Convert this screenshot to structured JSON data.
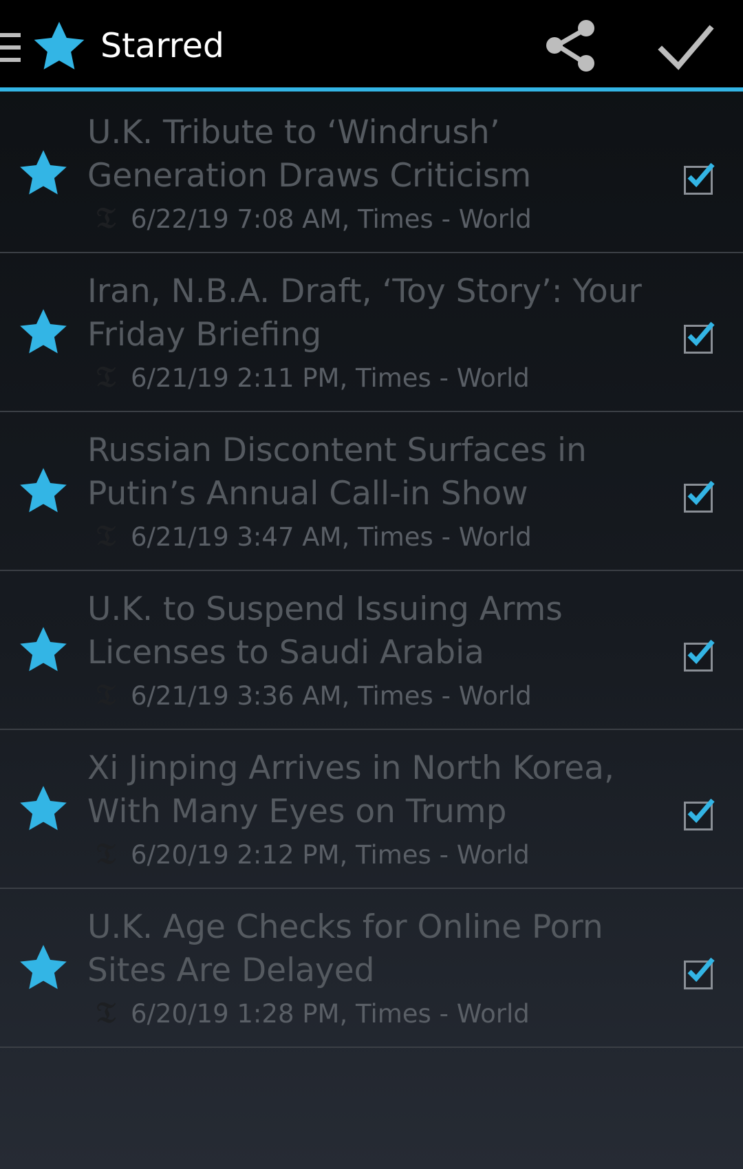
{
  "action_bar": {
    "title": "Starred",
    "icons": [
      "menu-icon",
      "star-icon",
      "share-icon",
      "checkmark-icon"
    ]
  },
  "colors": {
    "accent": "#33b5e5",
    "action_bar_bg": "#000000",
    "headline_text": "#555a60",
    "meta_text": "#5a5f66"
  },
  "articles": [
    {
      "headline_line1": "U.K. Tribute to ‘Windrush’",
      "headline_line2": "Generation Draws Criticism",
      "meta": "6/22/19 7:08 AM, Times - World",
      "starred": true,
      "checked": true
    },
    {
      "headline_line1": "Iran, N.B.A. Draft, ‘Toy Story’: Your",
      "headline_line2": "Friday Briefing",
      "meta": "6/21/19 2:11 PM, Times - World",
      "starred": true,
      "checked": true
    },
    {
      "headline_line1": "Russian Discontent Surfaces in",
      "headline_line2": "Putin’s Annual Call-in Show",
      "meta": "6/21/19 3:47 AM, Times - World",
      "starred": true,
      "checked": true
    },
    {
      "headline_line1": "U.K. to Suspend Issuing Arms",
      "headline_line2": "Licenses to Saudi Arabia",
      "meta": "6/21/19 3:36 AM, Times - World",
      "starred": true,
      "checked": true
    },
    {
      "headline_line1": "Xi Jinping Arrives in North Korea,",
      "headline_line2": "With Many Eyes on Trump",
      "meta": "6/20/19 2:12 PM, Times - World",
      "starred": true,
      "checked": true
    },
    {
      "headline_line1": "U.K. Age Checks for Online Porn",
      "headline_line2": "Sites Are Delayed",
      "meta": "6/20/19 1:28 PM, Times - World",
      "starred": true,
      "checked": true
    }
  ]
}
